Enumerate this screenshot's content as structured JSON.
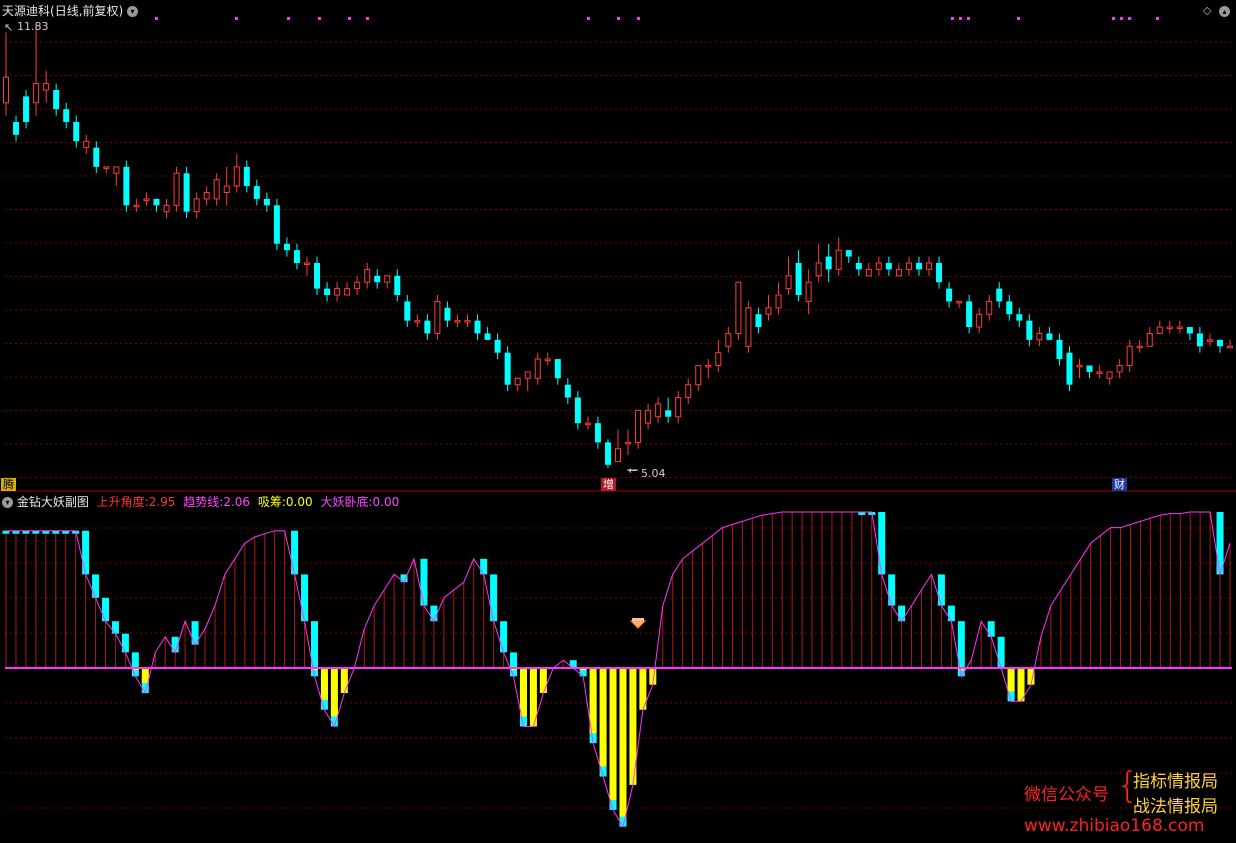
{
  "stock_title": "天源迪科",
  "period_label": "(日线,前复权)",
  "high_label": "11.83",
  "low_label": "5.04",
  "markers": {
    "left": "腾",
    "mid": "增",
    "right": "财"
  },
  "indicator": {
    "name": "金钻大妖副图",
    "params": [
      {
        "label": "上升角度:",
        "value": "2.95",
        "color": "#ff3333"
      },
      {
        "label": "趋势线:",
        "value": "2.06",
        "color": "#ff44ff"
      },
      {
        "label": "吸筹:",
        "value": "0.00",
        "color": "#ffff00"
      },
      {
        "label": "大妖卧底:",
        "value": "0.00",
        "color": "#ff44ff"
      }
    ]
  },
  "watermark": {
    "wechat": "微信公众号",
    "line1": "指标情报局",
    "line2": "战法情报局",
    "url": "www.zhibiao168.com"
  },
  "colors": {
    "up": "#ff3b3b",
    "down": "#00ffff",
    "absorb": "#ffff00",
    "trend": "#ff33ff",
    "grid": "#7a0000"
  },
  "chart_data": {
    "type": "candlestick",
    "price_high": 11.83,
    "price_low": 5.04,
    "candles": [
      [
        10.6,
        11.0,
        11.7,
        10.4
      ],
      [
        10.3,
        10.1,
        10.4,
        10.0
      ],
      [
        10.7,
        10.3,
        10.8,
        10.2
      ],
      [
        10.6,
        10.9,
        11.83,
        10.4
      ],
      [
        10.8,
        10.9,
        11.1,
        10.6
      ],
      [
        10.8,
        10.5,
        10.9,
        10.4
      ],
      [
        10.5,
        10.3,
        10.6,
        10.2
      ],
      [
        10.3,
        10.0,
        10.4,
        9.9
      ],
      [
        9.9,
        10.0,
        10.1,
        9.8
      ],
      [
        9.9,
        9.6,
        10.0,
        9.5
      ],
      [
        9.6,
        9.6,
        9.6,
        9.5
      ],
      [
        9.5,
        9.6,
        9.6,
        9.3
      ],
      [
        9.6,
        9.0,
        9.7,
        8.9
      ],
      [
        9.0,
        9.0,
        9.1,
        8.9
      ],
      [
        9.1,
        9.1,
        9.2,
        9.0
      ],
      [
        9.1,
        9.0,
        9.1,
        8.9
      ],
      [
        8.9,
        9.0,
        9.1,
        8.8
      ],
      [
        9.0,
        9.5,
        9.6,
        8.9
      ],
      [
        9.5,
        8.9,
        9.6,
        8.8
      ],
      [
        8.9,
        9.1,
        9.2,
        8.8
      ],
      [
        9.1,
        9.2,
        9.3,
        9.0
      ],
      [
        9.1,
        9.4,
        9.5,
        9.0
      ],
      [
        9.2,
        9.3,
        9.6,
        9.0
      ],
      [
        9.3,
        9.6,
        9.8,
        9.2
      ],
      [
        9.6,
        9.3,
        9.7,
        9.2
      ],
      [
        9.3,
        9.1,
        9.4,
        9.0
      ],
      [
        9.1,
        9.0,
        9.2,
        8.9
      ],
      [
        9.0,
        8.4,
        9.1,
        8.3
      ],
      [
        8.4,
        8.3,
        8.5,
        8.2
      ],
      [
        8.3,
        8.1,
        8.4,
        8.0
      ],
      [
        8.1,
        8.1,
        8.2,
        7.9
      ],
      [
        8.1,
        7.7,
        8.2,
        7.6
      ],
      [
        7.7,
        7.6,
        7.8,
        7.5
      ],
      [
        7.6,
        7.7,
        7.8,
        7.5
      ],
      [
        7.6,
        7.7,
        7.8,
        7.6
      ],
      [
        7.7,
        7.8,
        7.9,
        7.6
      ],
      [
        7.8,
        8.0,
        8.1,
        7.7
      ],
      [
        7.9,
        7.8,
        8.0,
        7.7
      ],
      [
        7.8,
        7.9,
        7.9,
        7.7
      ],
      [
        7.9,
        7.6,
        8.0,
        7.5
      ],
      [
        7.5,
        7.2,
        7.6,
        7.1
      ],
      [
        7.2,
        7.2,
        7.3,
        7.1
      ],
      [
        7.2,
        7.0,
        7.3,
        6.9
      ],
      [
        7.0,
        7.5,
        7.6,
        6.9
      ],
      [
        7.4,
        7.2,
        7.5,
        7.1
      ],
      [
        7.2,
        7.2,
        7.3,
        7.1
      ],
      [
        7.2,
        7.2,
        7.3,
        7.1
      ],
      [
        7.2,
        7.0,
        7.3,
        6.9
      ],
      [
        7.0,
        6.9,
        7.1,
        6.9
      ],
      [
        6.9,
        6.7,
        7.0,
        6.6
      ],
      [
        6.7,
        6.2,
        6.8,
        6.1
      ],
      [
        6.2,
        6.3,
        6.3,
        6.1
      ],
      [
        6.3,
        6.4,
        6.4,
        6.1
      ],
      [
        6.3,
        6.6,
        6.7,
        6.2
      ],
      [
        6.6,
        6.6,
        6.7,
        6.5
      ],
      [
        6.6,
        6.3,
        6.6,
        6.2
      ],
      [
        6.2,
        6.0,
        6.3,
        5.9
      ],
      [
        6.0,
        5.6,
        6.1,
        5.5
      ],
      [
        5.6,
        5.6,
        5.7,
        5.5
      ],
      [
        5.6,
        5.3,
        5.7,
        5.2
      ],
      [
        5.3,
        4.95,
        5.35,
        4.9
      ],
      [
        5.0,
        5.2,
        5.5,
        5.04
      ],
      [
        5.3,
        5.3,
        5.5,
        5.1
      ],
      [
        5.3,
        5.8,
        5.8,
        5.2
      ],
      [
        5.6,
        5.8,
        5.9,
        5.5
      ],
      [
        5.7,
        5.9,
        6.0,
        5.6
      ],
      [
        5.8,
        5.7,
        6.0,
        5.6
      ],
      [
        5.7,
        6.0,
        6.1,
        5.6
      ],
      [
        6.0,
        6.2,
        6.3,
        5.9
      ],
      [
        6.2,
        6.5,
        6.5,
        6.1
      ],
      [
        6.5,
        6.5,
        6.6,
        6.3
      ],
      [
        6.5,
        6.7,
        6.9,
        6.4
      ],
      [
        6.8,
        7.0,
        7.1,
        6.7
      ],
      [
        7.0,
        7.8,
        7.8,
        6.9
      ],
      [
        6.8,
        7.4,
        7.5,
        6.7
      ],
      [
        7.3,
        7.1,
        7.4,
        7.0
      ],
      [
        7.3,
        7.4,
        7.6,
        7.2
      ],
      [
        7.4,
        7.6,
        7.8,
        7.3
      ],
      [
        7.7,
        7.9,
        8.2,
        7.6
      ],
      [
        8.1,
        7.6,
        8.3,
        7.5
      ],
      [
        7.5,
        7.8,
        8.0,
        7.3
      ],
      [
        7.9,
        8.1,
        8.4,
        7.8
      ],
      [
        8.2,
        8.0,
        8.4,
        7.8
      ],
      [
        8.0,
        8.3,
        8.5,
        7.9
      ],
      [
        8.3,
        8.2,
        8.3,
        8.1
      ],
      [
        8.1,
        8.0,
        8.2,
        7.9
      ],
      [
        7.9,
        8.0,
        8.1,
        7.9
      ],
      [
        8.0,
        8.1,
        8.2,
        7.9
      ],
      [
        8.1,
        8.0,
        8.2,
        7.9
      ],
      [
        7.9,
        8.0,
        8.1,
        7.9
      ],
      [
        8.0,
        8.1,
        8.2,
        7.9
      ],
      [
        8.1,
        8.0,
        8.2,
        7.9
      ],
      [
        8.0,
        8.1,
        8.2,
        7.9
      ],
      [
        8.1,
        7.8,
        8.2,
        7.7
      ],
      [
        7.7,
        7.5,
        7.8,
        7.4
      ],
      [
        7.5,
        7.5,
        7.5,
        7.4
      ],
      [
        7.5,
        7.1,
        7.6,
        7.0
      ],
      [
        7.1,
        7.3,
        7.4,
        7.0
      ],
      [
        7.3,
        7.5,
        7.6,
        7.2
      ],
      [
        7.7,
        7.5,
        7.8,
        7.4
      ],
      [
        7.5,
        7.3,
        7.6,
        7.2
      ],
      [
        7.3,
        7.2,
        7.4,
        7.1
      ],
      [
        7.2,
        6.9,
        7.3,
        6.8
      ],
      [
        6.9,
        7.0,
        7.1,
        6.8
      ],
      [
        7.0,
        6.9,
        7.1,
        6.9
      ],
      [
        6.9,
        6.6,
        7.0,
        6.5
      ],
      [
        6.7,
        6.2,
        6.8,
        6.1
      ],
      [
        6.5,
        6.5,
        6.6,
        6.3
      ],
      [
        6.5,
        6.4,
        6.5,
        6.3
      ],
      [
        6.4,
        6.4,
        6.5,
        6.3
      ],
      [
        6.3,
        6.4,
        6.4,
        6.2
      ],
      [
        6.4,
        6.5,
        6.6,
        6.3
      ],
      [
        6.5,
        6.8,
        6.9,
        6.4
      ],
      [
        6.8,
        6.8,
        6.9,
        6.7
      ],
      [
        6.8,
        7.0,
        7.1,
        6.8
      ],
      [
        7.0,
        7.1,
        7.2,
        7.0
      ],
      [
        7.1,
        7.1,
        7.2,
        7.0
      ],
      [
        7.1,
        7.1,
        7.2,
        7.0
      ],
      [
        7.1,
        7.0,
        7.1,
        6.9
      ],
      [
        7.0,
        6.8,
        7.1,
        6.7
      ],
      [
        6.9,
        6.9,
        7.0,
        6.8
      ],
      [
        6.9,
        6.8,
        6.9,
        6.7
      ],
      [
        6.8,
        6.8,
        6.9,
        6.8
      ]
    ],
    "indicator_values": [
      88,
      88,
      88,
      88,
      88,
      88,
      88,
      88,
      60,
      45,
      30,
      22,
      10,
      -5,
      -15,
      10,
      20,
      10,
      30,
      15,
      25,
      40,
      60,
      70,
      80,
      84,
      86,
      88,
      88,
      60,
      30,
      -5,
      -25,
      -35,
      -15,
      0,
      25,
      40,
      50,
      60,
      55,
      70,
      40,
      30,
      45,
      50,
      55,
      70,
      60,
      30,
      10,
      -5,
      -35,
      -35,
      -15,
      0,
      5,
      0,
      -5,
      -45,
      -65,
      -85,
      -95,
      -70,
      -25,
      -10,
      40,
      60,
      70,
      75,
      80,
      85,
      90,
      92,
      94,
      96,
      98,
      99,
      100,
      100,
      100,
      100,
      100,
      100,
      100,
      100,
      100,
      100,
      60,
      40,
      30,
      40,
      50,
      60,
      40,
      30,
      -5,
      5,
      30,
      20,
      0,
      -20,
      -20,
      -10,
      20,
      40,
      50,
      60,
      70,
      80,
      85,
      90,
      90,
      92,
      94,
      96,
      98,
      99,
      99,
      100,
      100,
      100,
      60,
      80
    ]
  }
}
